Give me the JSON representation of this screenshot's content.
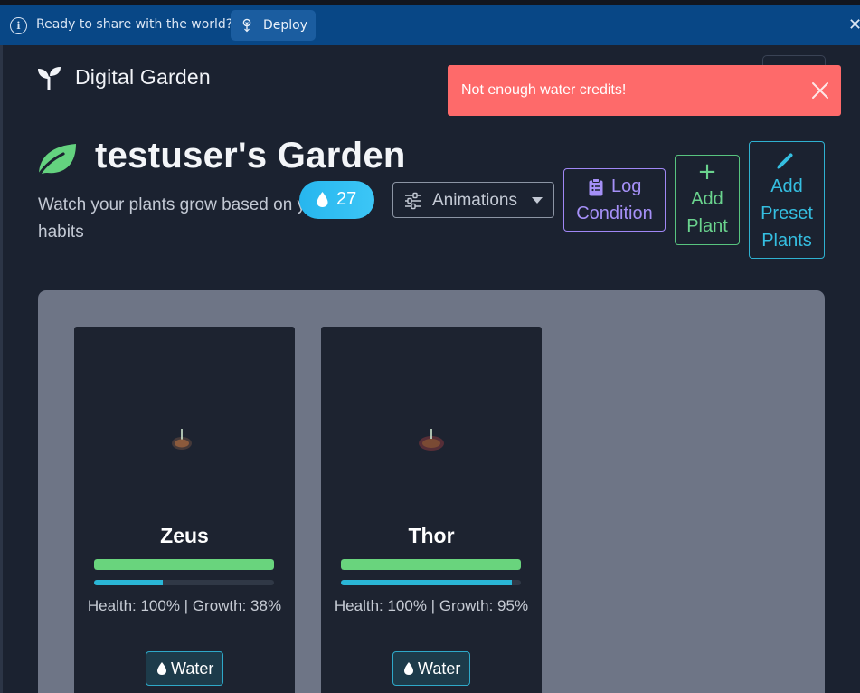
{
  "banner": {
    "text": "Ready to share with the world?",
    "deploy_label": "Deploy",
    "close_glyph": "✕"
  },
  "header": {
    "brand": "Digital Garden"
  },
  "toast": {
    "message": "Not enough water credits!",
    "color": "#fe6a6a"
  },
  "garden": {
    "title": "testuser's Garden",
    "subtitle": "Watch your plants grow based on your daily habits",
    "water_credits": "27"
  },
  "toolbar": {
    "animations_label": "Animations",
    "log_condition_line1": "Log",
    "log_condition_line2": "Condition",
    "add_plant_icon": "+",
    "add_plant_line1": "Add",
    "add_plant_line2": "Plant",
    "add_preset_line1": "Add",
    "add_preset_line2": "Preset",
    "add_preset_line3": "Plants"
  },
  "plants": [
    {
      "name": "Zeus",
      "health_pct": 100,
      "growth_pct": 38,
      "stats_text": "Health: 100% | Growth: 38%",
      "water_label": "Water"
    },
    {
      "name": "Thor",
      "health_pct": 100,
      "growth_pct": 95,
      "stats_text": "Health: 100% | Growth: 95%",
      "water_label": "Water"
    }
  ],
  "colors": {
    "banner": "#084786",
    "background": "#1b2230",
    "health": "#69d47d",
    "growth": "#2ab6d6",
    "accent_purple": "#a590f7",
    "accent_green": "#6ad38e",
    "accent_cyan": "#35bfe1"
  },
  "icons": {
    "banner": "info-icon",
    "deploy": "rocket-icon",
    "brand": "seedling-icon",
    "garden": "leaf-icon",
    "credits": "water-drop-icon",
    "animations": "sliders-icon",
    "log_condition": "clipboard-list-icon",
    "add_plant": "plus-icon",
    "add_preset": "pencil-icon"
  }
}
